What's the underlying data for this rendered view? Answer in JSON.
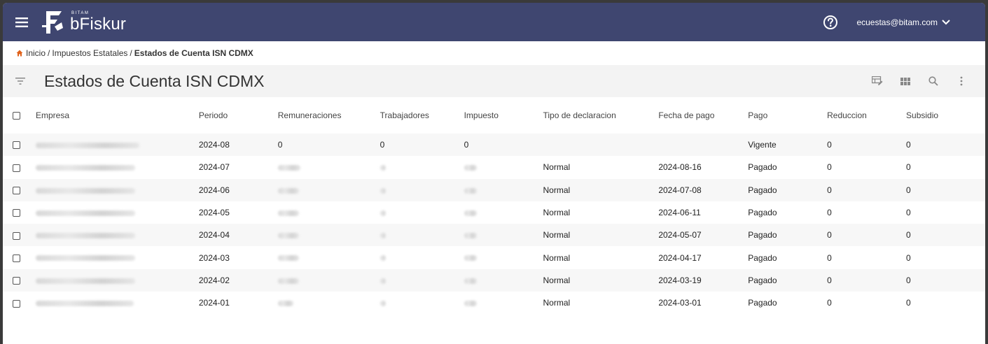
{
  "app": {
    "brand_small": "BITAM",
    "brand_name": "bFiskur",
    "user_email": "ecuestas@bitam.com"
  },
  "breadcrumb": {
    "home": "Inicio",
    "section": "Impuestos Estatales",
    "current": "Estados de Cuenta ISN CDMX",
    "separator": "/"
  },
  "page": {
    "title": "Estados de Cuenta ISN CDMX"
  },
  "colors": {
    "topbar": "#3f4670",
    "home_icon": "#e0621b",
    "toolbar_bg": "#f3f3f3"
  },
  "table": {
    "headers": [
      "Empresa",
      "Periodo",
      "Remuneraciones",
      "Trabajadores",
      "Impuesto",
      "Tipo de declaracion",
      "Fecha de pago",
      "Pago",
      "Reduccion",
      "Subsidio"
    ],
    "rows": [
      {
        "empresa": "",
        "periodo": "2024-08",
        "remuneraciones": "0",
        "trabajadores": "0",
        "impuesto": "0",
        "tipo": "",
        "fecha": "",
        "pago": "Vigente",
        "reduccion": "0",
        "subsidio": "0"
      },
      {
        "empresa": "",
        "periodo": "2024-07",
        "remuneraciones": "",
        "trabajadores": "",
        "impuesto": "",
        "tipo": "Normal",
        "fecha": "2024-08-16",
        "pago": "Pagado",
        "reduccion": "0",
        "subsidio": "0"
      },
      {
        "empresa": "",
        "periodo": "2024-06",
        "remuneraciones": "",
        "trabajadores": "",
        "impuesto": "",
        "tipo": "Normal",
        "fecha": "2024-07-08",
        "pago": "Pagado",
        "reduccion": "0",
        "subsidio": "0"
      },
      {
        "empresa": "",
        "periodo": "2024-05",
        "remuneraciones": "",
        "trabajadores": "",
        "impuesto": "",
        "tipo": "Normal",
        "fecha": "2024-06-11",
        "pago": "Pagado",
        "reduccion": "0",
        "subsidio": "0"
      },
      {
        "empresa": "",
        "periodo": "2024-04",
        "remuneraciones": "",
        "trabajadores": "",
        "impuesto": "",
        "tipo": "Normal",
        "fecha": "2024-05-07",
        "pago": "Pagado",
        "reduccion": "0",
        "subsidio": "0"
      },
      {
        "empresa": "",
        "periodo": "2024-03",
        "remuneraciones": "",
        "trabajadores": "",
        "impuesto": "",
        "tipo": "Normal",
        "fecha": "2024-04-17",
        "pago": "Pagado",
        "reduccion": "0",
        "subsidio": "0"
      },
      {
        "empresa": "",
        "periodo": "2024-02",
        "remuneraciones": "",
        "trabajadores": "",
        "impuesto": "",
        "tipo": "Normal",
        "fecha": "2024-03-19",
        "pago": "Pagado",
        "reduccion": "0",
        "subsidio": "0"
      },
      {
        "empresa": "",
        "periodo": "2024-01",
        "remuneraciones": "",
        "trabajadores": "",
        "impuesto": "",
        "tipo": "Normal",
        "fecha": "2024-03-01",
        "pago": "Pagado",
        "reduccion": "0",
        "subsidio": "0"
      }
    ]
  }
}
